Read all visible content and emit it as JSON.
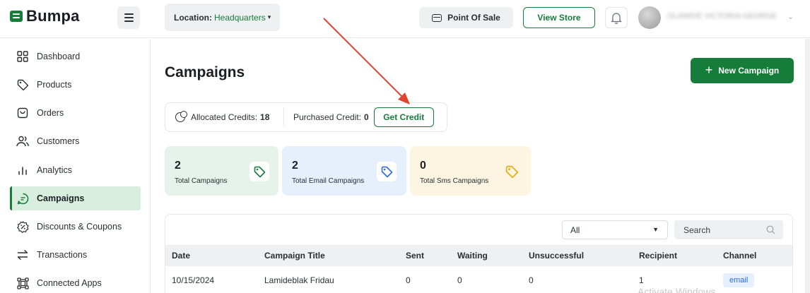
{
  "brand": {
    "name": "Bumpa",
    "color": "#167c3a"
  },
  "header": {
    "location_label": "Location:",
    "location_value": "Headquarters",
    "pos_label": "Point Of Sale",
    "view_store_label": "View Store",
    "user_name": "OLAMIDE VICTORIA GEORGE"
  },
  "sidebar": {
    "items": [
      {
        "label": "Dashboard",
        "icon": "grid-icon"
      },
      {
        "label": "Products",
        "icon": "tag-icon"
      },
      {
        "label": "Orders",
        "icon": "bag-icon"
      },
      {
        "label": "Customers",
        "icon": "users-icon"
      },
      {
        "label": "Analytics",
        "icon": "bar-chart-icon"
      },
      {
        "label": "Campaigns",
        "icon": "message-icon",
        "active": true
      },
      {
        "label": "Discounts & Coupons",
        "icon": "discount-icon"
      },
      {
        "label": "Transactions",
        "icon": "transfer-icon"
      },
      {
        "label": "Connected Apps",
        "icon": "apps-icon"
      }
    ]
  },
  "main": {
    "title": "Campaigns",
    "new_campaign_label": "New Campaign",
    "credits": {
      "allocated_label": "Allocated Credits:",
      "allocated_value": "18",
      "purchased_label": "Purchased Credit:",
      "purchased_value": "0",
      "get_credit_label": "Get Credit"
    },
    "stats": [
      {
        "value": "2",
        "label": "Total Campaigns",
        "bg": "#e6f3eb",
        "icon_color": "#167c3a"
      },
      {
        "value": "2",
        "label": "Total Email Campaigns",
        "bg": "#e6effc",
        "icon_color": "#2d6be4"
      },
      {
        "value": "0",
        "label": "Total Sms Campaigns",
        "bg": "#fdf5e2",
        "icon_color": "#e3b21a"
      }
    ],
    "table": {
      "filter_value": "All",
      "search_placeholder": "Search",
      "columns": [
        "Date",
        "Campaign Title",
        "Sent",
        "Waiting",
        "Unsuccessful",
        "Recipient",
        "Channel"
      ],
      "rows": [
        {
          "date": "10/15/2024",
          "title": "Lamideblak Fridau",
          "sent": "0",
          "waiting": "0",
          "unsuccessful": "0",
          "recipient": "1",
          "channel": "email"
        }
      ]
    },
    "watermark": "Activate Windows"
  }
}
